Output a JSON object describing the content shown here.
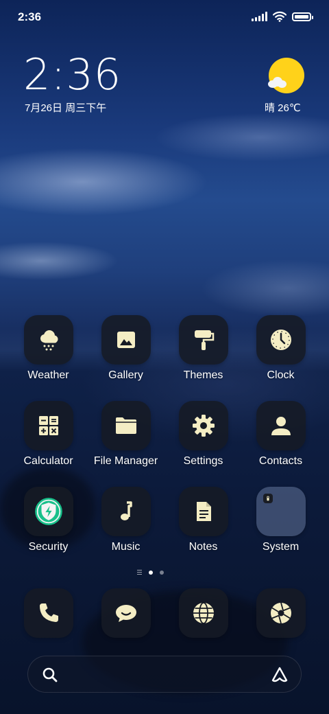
{
  "status_bar": {
    "time": "2:36",
    "icons": [
      "signal-icon",
      "wifi-icon",
      "battery-icon"
    ]
  },
  "widget": {
    "time": "2:36",
    "date": "7月26日 周三下午",
    "weather_text": "晴 26℃",
    "weather_icon": "sunny-cloud-icon"
  },
  "apps": [
    {
      "label": "Weather",
      "icon": "weather-icon"
    },
    {
      "label": "Gallery",
      "icon": "gallery-icon"
    },
    {
      "label": "Themes",
      "icon": "paint-roller-icon"
    },
    {
      "label": "Clock",
      "icon": "clock-icon"
    },
    {
      "label": "Calculator",
      "icon": "calculator-icon"
    },
    {
      "label": "File Manager",
      "icon": "folder-icon"
    },
    {
      "label": "Settings",
      "icon": "gear-icon"
    },
    {
      "label": "Contacts",
      "icon": "person-icon"
    },
    {
      "label": "Security",
      "icon": "shield-icon"
    },
    {
      "label": "Music",
      "icon": "music-note-icon"
    },
    {
      "label": "Notes",
      "icon": "notes-icon"
    },
    {
      "label": "System",
      "icon": "folder-system-icon"
    }
  ],
  "pager": {
    "pages": 2,
    "active": 1
  },
  "dock": [
    {
      "name": "phone",
      "icon": "phone-icon"
    },
    {
      "name": "messages",
      "icon": "chat-icon"
    },
    {
      "name": "browser",
      "icon": "globe-icon"
    },
    {
      "name": "camera",
      "icon": "camera-aperture-icon"
    }
  ],
  "search": {
    "icon": "search-icon",
    "assistant_icon": "assistant-icon"
  },
  "colors": {
    "icon_fill": "#f4edc4",
    "sun": "#ffd21a",
    "security_green": "#18c08a",
    "tile_bg": "#161a24"
  }
}
